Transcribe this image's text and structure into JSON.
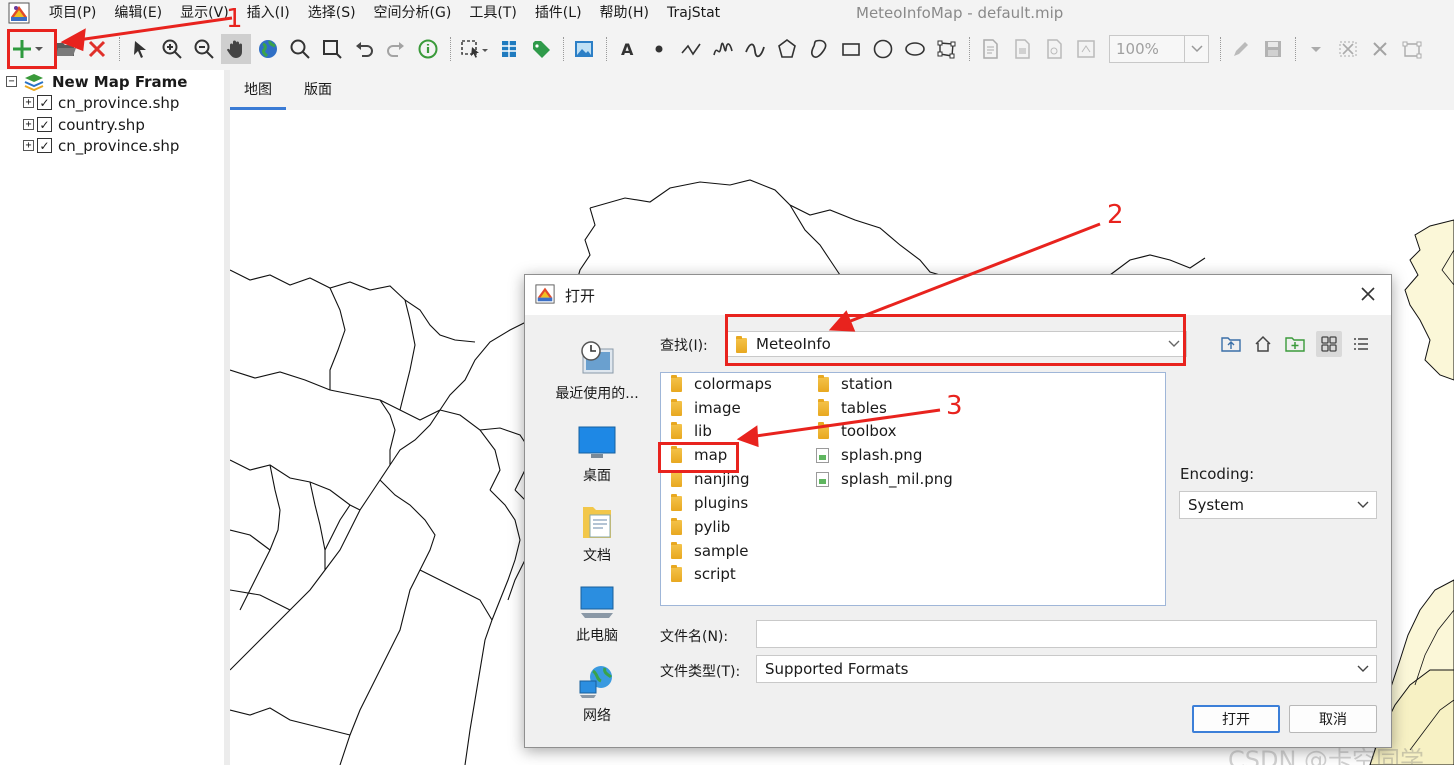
{
  "app": {
    "window_title": "MeteoInfoMap - default.mip",
    "icon": "meteoinfo-logo-icon"
  },
  "menu": [
    "项目(P)",
    "编辑(E)",
    "显示(V)",
    "插入(I)",
    "选择(S)",
    "空间分析(G)",
    "工具(T)",
    "插件(L)",
    "帮助(H)",
    "TrajStat"
  ],
  "toolbar": {
    "zoom_value": "100%",
    "icons": [
      "add-layer-icon",
      "open-folder-icon",
      "remove-layer-icon",
      "select-arrow-icon",
      "zoom-in-icon",
      "zoom-out-icon",
      "pan-hand-icon",
      "full-extent-globe-icon",
      "magnifier-icon",
      "zoom-rectangle-icon",
      "undo-icon",
      "redo-icon",
      "identify-info-icon",
      "select-features-icon",
      "attribute-table-icon",
      "label-tag-icon",
      "image-icon",
      "text-icon",
      "point-icon",
      "polyline-icon",
      "freehand-line-icon",
      "curve-icon",
      "polygon-icon",
      "freehand-polygon-icon",
      "rectangle-icon",
      "circle-icon",
      "ellipse-icon",
      "edit-vertices-icon",
      "layout-page-icon",
      "export-icon",
      "print-icon",
      "refresh-icon",
      "edit-pencil-icon",
      "save-icon",
      "dropdown-arrow-icon",
      "cut-shape-icon",
      "delete-shape-icon",
      "snap-icon"
    ]
  },
  "layers": {
    "frame_name": "New Map Frame",
    "items": [
      {
        "name": "cn_province.shp",
        "checked": true
      },
      {
        "name": "country.shp",
        "checked": true
      },
      {
        "name": "cn_province.shp",
        "checked": true
      }
    ]
  },
  "tabs": [
    "地图",
    "版面"
  ],
  "dialog": {
    "title": "打开",
    "places": [
      {
        "label": "最近使用的...",
        "icon": "recent-items-icon"
      },
      {
        "label": "桌面",
        "icon": "desktop-icon"
      },
      {
        "label": "文档",
        "icon": "documents-icon"
      },
      {
        "label": "此电脑",
        "icon": "this-pc-icon"
      },
      {
        "label": "网络",
        "icon": "network-icon"
      }
    ],
    "look_in_label": "查找(I):",
    "look_in_value": "MeteoInfo",
    "header_buttons": [
      "up-folder-icon",
      "home-icon",
      "new-folder-icon",
      "list-view-icon",
      "details-view-icon"
    ],
    "folders_col1": [
      "colormaps",
      "image",
      "lib",
      "map",
      "nanjing",
      "plugins",
      "pylib",
      "sample",
      "script"
    ],
    "folders_col2": [
      "station",
      "tables",
      "toolbox"
    ],
    "files_col2": [
      "splash.png",
      "splash_mil.png"
    ],
    "encoding_label": "Encoding:",
    "encoding_value": "System",
    "file_name_label": "文件名(N):",
    "file_name_value": "",
    "file_type_label": "文件类型(T):",
    "file_type_value": "Supported Formats",
    "open_button": "打开",
    "cancel_button": "取消"
  },
  "annotations": {
    "color": "#e8231e",
    "numbers": [
      "1",
      "2",
      "3"
    ]
  },
  "watermark": "CSDN @卡空同学",
  "colors": {
    "accent": "#3a7bd5",
    "annotation_red": "#e8231e",
    "land_fill": "#fbf7d8"
  }
}
